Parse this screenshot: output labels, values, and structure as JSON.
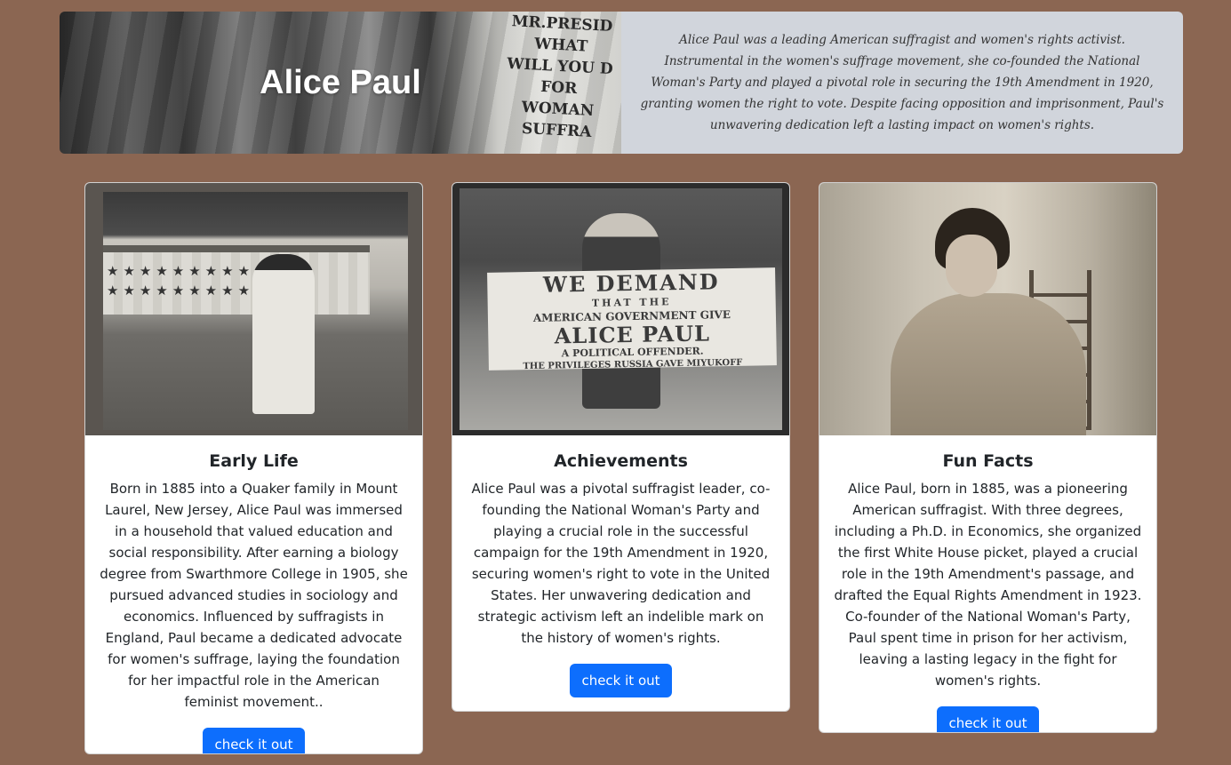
{
  "hero": {
    "title": "Alice Paul",
    "description": "Alice Paul was a leading American suffragist and women's rights activist. Instrumental in the women's suffrage movement, she co-founded the National Woman's Party and played a pivotal role in securing the 19th Amendment in 1920, granting women the right to vote. Despite facing opposition and imprisonment, Paul's unwavering dedication left a lasting impact on women's rights.",
    "photo_sign_lines": [
      "MR.PRESID",
      "WHAT",
      "WILL YOU D",
      "FOR",
      "WOMAN SUFFRA"
    ]
  },
  "cards": [
    {
      "title": "Early Life",
      "text": "Born in 1885 into a Quaker family in Mount Laurel, New Jersey, Alice Paul was immersed in a household that valued education and social responsibility. After earning a biology degree from Swarthmore College in 1905, she pursued advanced studies in sociology and economics. Influenced by suffragists in England, Paul became a dedicated advocate for women's suffrage, laying the foundation for her impactful role in the American feminist movement..",
      "button": "check it out"
    },
    {
      "title": "Achievements",
      "text": "Alice Paul was a pivotal suffragist leader, co-founding the National Woman's Party and playing a crucial role in the successful campaign for the 19th Amendment in 1920, securing women's right to vote in the United States. Her unwavering dedication and strategic activism left an indelible mark on the history of women's rights.",
      "button": "check it out",
      "banner_lines": [
        "WE DEMAND",
        "THAT THE",
        "AMERICAN GOVERNMENT GIVE",
        "ALICE PAUL",
        "A POLITICAL OFFENDER.",
        "THE PRIVILEGES RUSSIA GAVE MIYUKOFF"
      ]
    },
    {
      "title": "Fun Facts",
      "text": "Alice Paul, born in 1885, was a pioneering American suffragist. With three degrees, including a Ph.D. in Economics, she organized the first White House picket, played a crucial role in the 19th Amendment's passage, and drafted the Equal Rights Amendment in 1923. Co-founder of the National Woman's Party, Paul spent time in prison for her activism, leaving a lasting legacy in the fight for women's rights.",
      "button": "check it out"
    }
  ],
  "colors": {
    "background": "#8b6652",
    "hero_desc_bg": "#d1d5dc",
    "button": "#0d6efd"
  }
}
